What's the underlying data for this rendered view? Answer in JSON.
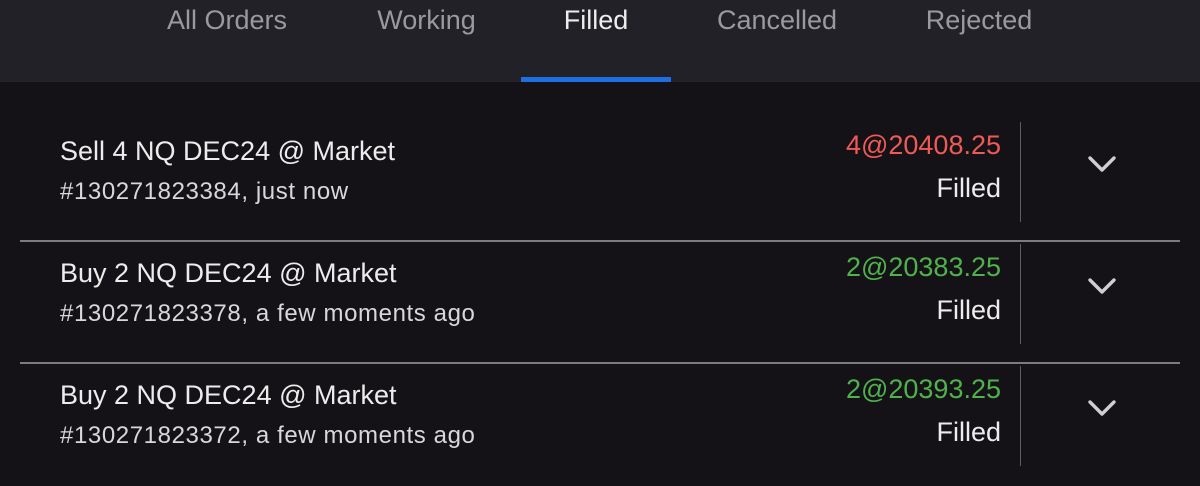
{
  "tabs": [
    {
      "label": "All Orders",
      "active": false
    },
    {
      "label": "Working",
      "active": false
    },
    {
      "label": "Filled",
      "active": true
    },
    {
      "label": "Cancelled",
      "active": false
    },
    {
      "label": "Rejected",
      "active": false
    }
  ],
  "colors": {
    "sell": "#f05a55",
    "buy": "#4fb24b",
    "active_tab_underline": "#1f6fe3"
  },
  "orders": [
    {
      "title": "Sell 4 NQ DEC24 @ Market",
      "subtitle": "#130271823384, just now",
      "fill": "4@20408.25",
      "side": "sell",
      "status": "Filled",
      "expand_icon": "chevron-down-icon"
    },
    {
      "title": "Buy 2 NQ DEC24 @ Market",
      "subtitle": "#130271823378, a few moments ago",
      "fill": "2@20383.25",
      "side": "buy",
      "status": "Filled",
      "expand_icon": "chevron-down-icon"
    },
    {
      "title": "Buy 2 NQ DEC24 @ Market",
      "subtitle": "#130271823372, a few moments ago",
      "fill": "2@20393.25",
      "side": "buy",
      "status": "Filled",
      "expand_icon": "chevron-down-icon"
    }
  ]
}
